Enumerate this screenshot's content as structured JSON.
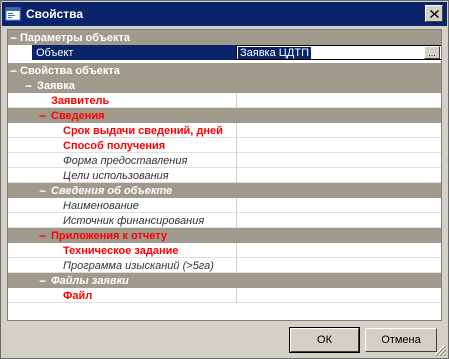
{
  "window": {
    "title": "Свойства",
    "close_label": "X"
  },
  "grid": {
    "params_category": "Параметры объекта",
    "object_row": {
      "name": "Объект",
      "value": "Заявка ЦДТП",
      "button": "..."
    },
    "props_category": "Свойства объекта",
    "zayavka_category": "Заявка",
    "zayavitel": "Заявитель",
    "svedeniya_category": "Сведения",
    "srok": "Срок выдачи сведений, дней",
    "sposob": "Способ получения",
    "forma": "Форма предоставления",
    "celi": "Цели использования",
    "svedeniya_ob_category": "Сведения об объекте",
    "naimenovanie": "Наименование",
    "istochnik": "Источник финансирования",
    "prilozheniya_category": "Приложения к отчету",
    "tehzadanie": "Техническое задание",
    "programma": "Программа изысканий (>5га)",
    "faily_category": "Файлы заявки",
    "fail": "Файл"
  },
  "toggles": {
    "collapse": "−"
  },
  "buttons": {
    "ok": "ОК",
    "cancel": "Отмена"
  },
  "colors": {
    "titlebar": "#0a246a",
    "category_bg": "#a09a8c",
    "required_red": "#ff0000",
    "face": "#d4d0c8"
  }
}
